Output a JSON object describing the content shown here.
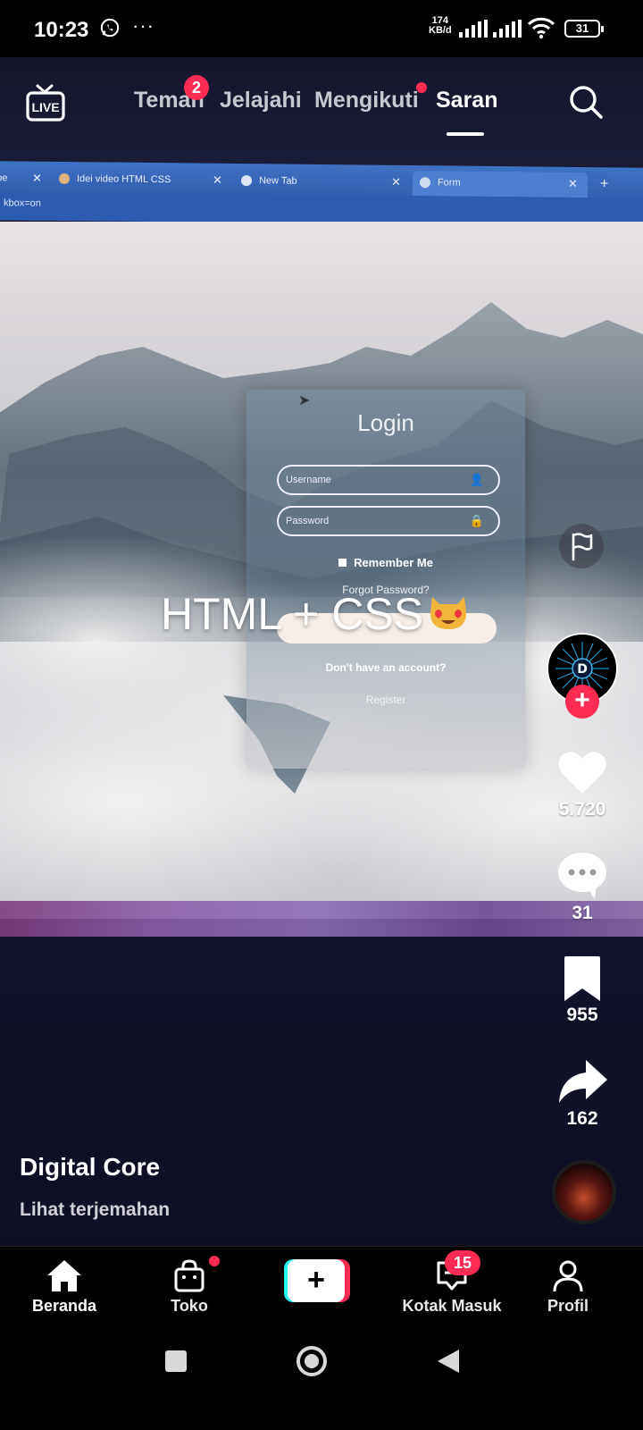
{
  "status_bar": {
    "time": "10:23",
    "overflow": "···",
    "net_speed": "174",
    "net_unit": "KB/d",
    "battery": "31"
  },
  "header": {
    "live_label": "LIVE",
    "tabs": [
      {
        "label": "Teman",
        "badge": "2"
      },
      {
        "label": "Jelajahi"
      },
      {
        "label": "Mengikuti",
        "dot": true
      },
      {
        "label": "Saran",
        "active": true
      }
    ]
  },
  "video": {
    "browser_tabs": [
      {
        "label": "ube"
      },
      {
        "label": "Idei video HTML CSS"
      },
      {
        "label": "New Tab"
      },
      {
        "label": "Form"
      }
    ],
    "new_tab_symbol": "+",
    "url_fragment": "kbox=on",
    "login_form": {
      "title": "Login",
      "username_placeholder": "Username",
      "password_placeholder": "Password",
      "remember": "Remember Me",
      "forgot": "Forgot Password?",
      "no_account": "Don't have an account?",
      "register": "Register"
    },
    "overlay_text": "HTML + CSS"
  },
  "rail": {
    "avatar_letter": "D",
    "likes": "5.720",
    "comments": "31",
    "saves": "955",
    "shares": "162"
  },
  "caption": {
    "author": "Digital Core",
    "translate": "Lihat terjemahan"
  },
  "bottom_nav": {
    "home": "Beranda",
    "shop": "Toko",
    "inbox": "Kotak Masuk",
    "inbox_badge": "15",
    "profile": "Profil"
  },
  "colors": {
    "accent": "#fe2c55",
    "create_cyan": "#25f4ee"
  }
}
